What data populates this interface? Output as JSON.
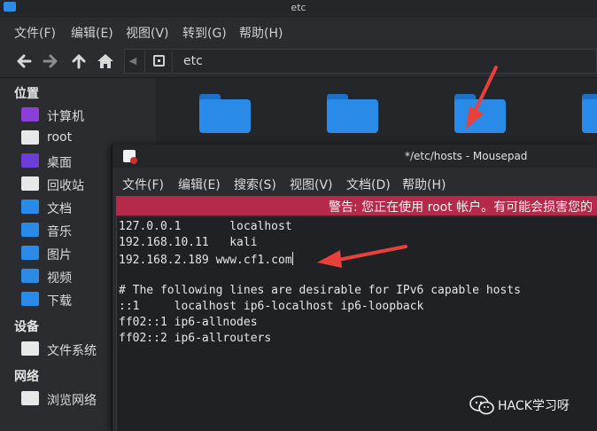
{
  "file_manager": {
    "title": "etc",
    "menu": [
      "文件(F)",
      "编辑(E)",
      "视图(V)",
      "转到(G)",
      "帮助(H)"
    ],
    "path_segment": "etc",
    "sidebar": {
      "places_header": "位置",
      "places": [
        {
          "label": "计算机",
          "icon": "computer-icon",
          "color": "#8a3fd6"
        },
        {
          "label": "root",
          "icon": "home-folder-icon",
          "color": "#e8e8e8"
        },
        {
          "label": "桌面",
          "icon": "desktop-icon",
          "color": "#6b3fd6"
        },
        {
          "label": "回收站",
          "icon": "trash-icon",
          "color": "#e8e8e8"
        },
        {
          "label": "文档",
          "icon": "documents-folder-icon",
          "color": "#2a8ae8"
        },
        {
          "label": "音乐",
          "icon": "music-folder-icon",
          "color": "#2a8ae8"
        },
        {
          "label": "图片",
          "icon": "pictures-folder-icon",
          "color": "#2a8ae8"
        },
        {
          "label": "视频",
          "icon": "videos-folder-icon",
          "color": "#2a8ae8"
        },
        {
          "label": "下载",
          "icon": "downloads-folder-icon",
          "color": "#2a8ae8"
        }
      ],
      "devices_header": "设备",
      "devices": [
        {
          "label": "文件系统",
          "icon": "filesystem-icon",
          "color": "#e8e8e8"
        }
      ],
      "network_header": "网络",
      "network": [
        {
          "label": "浏览网络",
          "icon": "network-icon",
          "color": "#e8e8e8"
        }
      ]
    }
  },
  "mousepad": {
    "title": "*/etc/hosts - Mousepad",
    "menu": [
      "文件(F)",
      "编辑(E)",
      "搜索(S)",
      "视图(V)",
      "文档(D)",
      "帮助(H)"
    ],
    "warning": "警告: 您正在使用 root 帐户。有可能会损害您的",
    "lines": [
      "127.0.0.1       localhost",
      "192.168.10.11   kali",
      "192.168.2.189 www.cf1.com",
      "",
      "# The following lines are desirable for IPv6 capable hosts",
      "::1     localhost ip6-localhost ip6-loopback",
      "ff02::1 ip6-allnodes",
      "ff02::2 ip6-allrouters"
    ]
  },
  "watermark": {
    "text": "HACK学习呀"
  },
  "colors": {
    "accent_folder": "#2a8ae8",
    "warning_bar": "#b52a4a",
    "annotation_arrow": "#e8403a"
  }
}
